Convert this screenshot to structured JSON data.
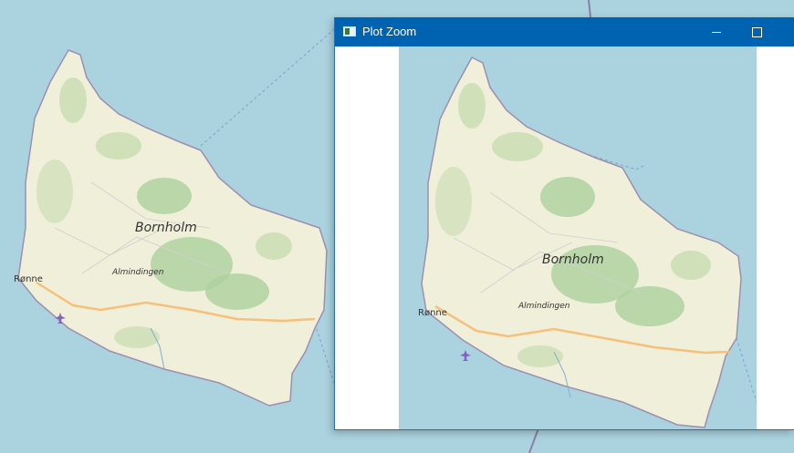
{
  "map": {
    "island_label": "Bornholm",
    "town_label": "Rønne",
    "forest_label": "Almindingen",
    "airport_icon": "airplane-icon",
    "colors": {
      "water": "#aad3df",
      "land": "#f0efd9",
      "forest": "#add19e",
      "road": "#f7c07a",
      "coast": "#9e8fb0"
    }
  },
  "zoom_window": {
    "title": "Plot Zoom",
    "minimize_label": "—",
    "maximize_label": "☐",
    "icon": "plot-zoom-app-icon"
  }
}
